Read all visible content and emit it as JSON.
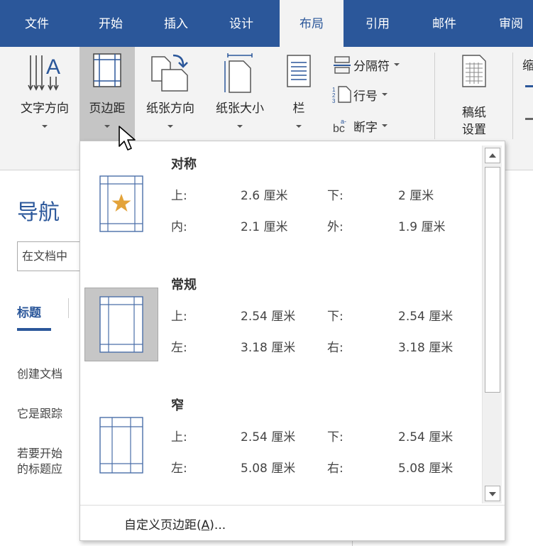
{
  "tabs": [
    "文件",
    "开始",
    "插入",
    "设计",
    "布局",
    "引用",
    "邮件",
    "审阅"
  ],
  "active_tab": "布局",
  "ribbon": {
    "text_direction": "文字方向",
    "margins": "页边距",
    "orientation": "纸张方向",
    "size": "纸张大小",
    "columns": "栏",
    "breaks": "分隔符",
    "line_numbers": "行号",
    "hyphenation": "断字",
    "draft_paper_line1": "稿纸",
    "draft_paper_line2": "设置",
    "cut_label": "缩"
  },
  "nav": {
    "title": "导航",
    "search_value": "在文档中",
    "tab_headings": "标题",
    "text1": "创建文档",
    "text2": "它是跟踪",
    "text3a": "若要开始",
    "text3b": "的标题应"
  },
  "dropdown": {
    "options": [
      {
        "name": "对称",
        "r1_l": "上:",
        "r1_v1": "2.6 厘米",
        "r1_r": "下:",
        "r1_v2": "2 厘米",
        "r2_l": "内:",
        "r2_v1": "2.1 厘米",
        "r2_r": "外:",
        "r2_v2": "1.9 厘米"
      },
      {
        "name": "常规",
        "r1_l": "上:",
        "r1_v1": "2.54 厘米",
        "r1_r": "下:",
        "r1_v2": "2.54 厘米",
        "r2_l": "左:",
        "r2_v1": "3.18 厘米",
        "r2_r": "右:",
        "r2_v2": "3.18 厘米"
      },
      {
        "name": "窄",
        "r1_l": "上:",
        "r1_v1": "2.54 厘米",
        "r1_r": "下:",
        "r1_v2": "2.54 厘米",
        "r2_l": "左:",
        "r2_v1": "5.08 厘米",
        "r2_r": "右:",
        "r2_v2": "5.08 厘米"
      }
    ],
    "custom_prefix": "自定义页边距(",
    "custom_key": "A",
    "custom_suffix": ")..."
  },
  "colors": {
    "brand": "#2b579a",
    "margin_line": "#4a6ea8",
    "star": "#e3a33a"
  }
}
